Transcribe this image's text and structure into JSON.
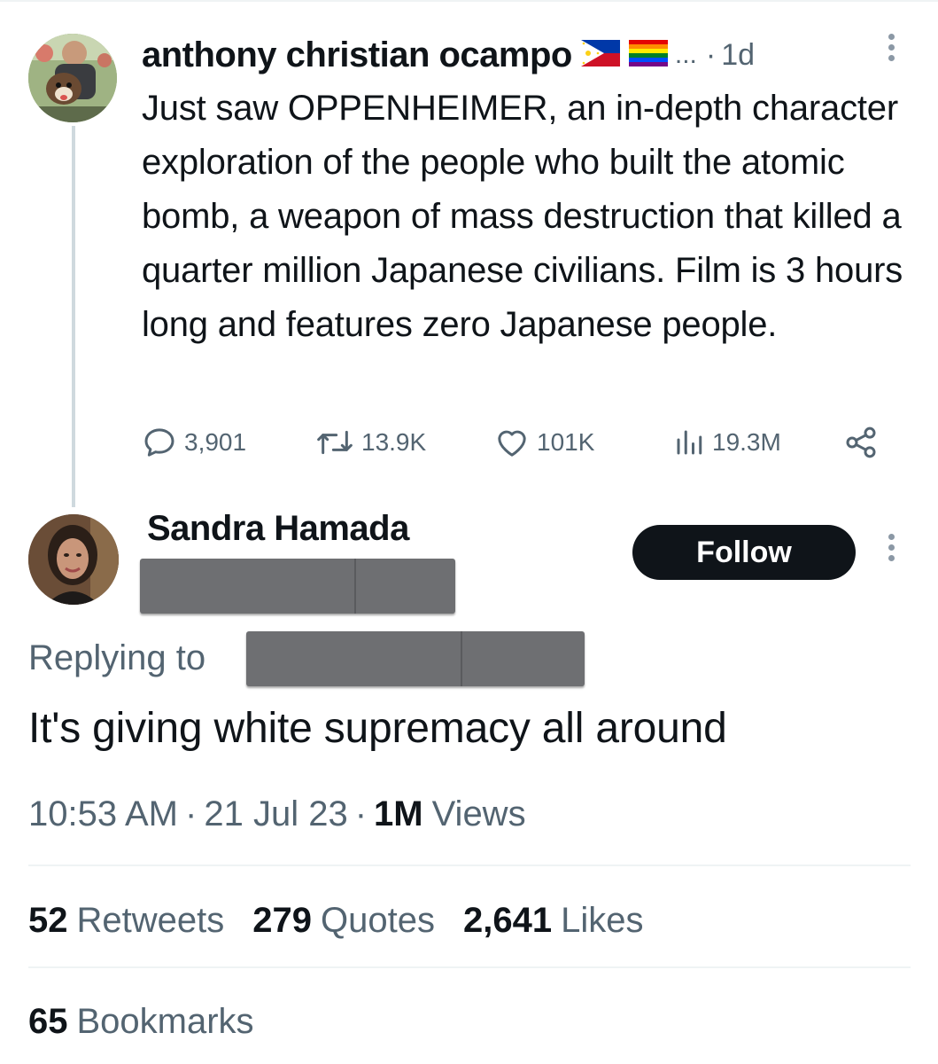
{
  "parent_tweet": {
    "author_name": "anthony christian ocampo",
    "author_flags": [
      "flag-philippines",
      "flag-rainbow"
    ],
    "truncation": "...",
    "separator": "·",
    "age": "1d",
    "text": "Just saw OPPENHEIMER, an in-depth character exploration of the people who built the atomic bomb, a weapon of mass destruction that killed a quarter million Japanese civilians. Film is 3 hours long and features zero Japanese people.",
    "actions": {
      "replies": "3,901",
      "retweets": "13.9K",
      "likes": "101K",
      "views": "19.3M"
    },
    "icons": {
      "reply": "reply-icon",
      "retweet": "retweet-icon",
      "like": "heart-icon",
      "views": "views-icon",
      "share": "share-icon",
      "more": "more-vertical-icon"
    }
  },
  "reply_tweet": {
    "author_name": "Sandra Hamada",
    "follow_label": "Follow",
    "replying_to_label": "Replying to",
    "text": "It's giving white supremacy all around",
    "time": "10:53 AM",
    "date": "21 Jul 23",
    "separator": "·",
    "views_count": "1M",
    "views_label": "Views",
    "stats": {
      "retweets_count": "52",
      "retweets_label": "Retweets",
      "quotes_count": "279",
      "quotes_label": "Quotes",
      "likes_count": "2,641",
      "likes_label": "Likes",
      "bookmarks_count": "65",
      "bookmarks_label": "Bookmarks"
    }
  },
  "colors": {
    "text_primary": "#0f1419",
    "text_secondary": "#536471",
    "divider": "#eff3f4",
    "thread_line": "#cfd9de",
    "follow_bg": "#0f1419",
    "redaction": "#6e6f72"
  }
}
